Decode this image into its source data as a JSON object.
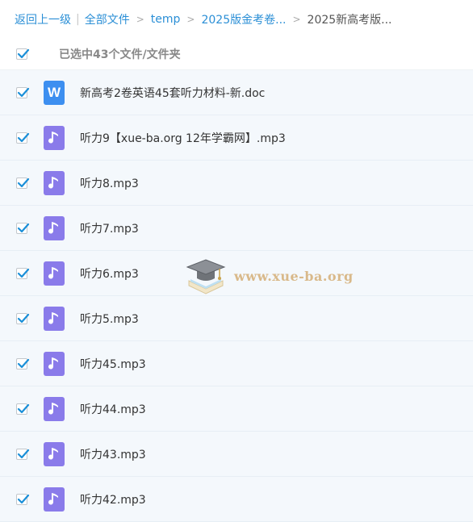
{
  "breadcrumb": {
    "back": "返回上一级",
    "all_files": "全部文件",
    "items": [
      "temp",
      "2025版金考卷...",
      "2025新高考版..."
    ]
  },
  "selection": {
    "all_checked": true,
    "label": "已选中43个文件/文件夹"
  },
  "files": [
    {
      "name": "新高考2卷英语45套听力材料-新.doc",
      "type": "doc",
      "icon_letter": "W",
      "checked": true
    },
    {
      "name": "听力9【xue-ba.org 12年学霸网】.mp3",
      "type": "mp3",
      "checked": true
    },
    {
      "name": "听力8.mp3",
      "type": "mp3",
      "checked": true
    },
    {
      "name": "听力7.mp3",
      "type": "mp3",
      "checked": true
    },
    {
      "name": "听力6.mp3",
      "type": "mp3",
      "checked": true
    },
    {
      "name": "听力5.mp3",
      "type": "mp3",
      "checked": true
    },
    {
      "name": "听力45.mp3",
      "type": "mp3",
      "checked": true
    },
    {
      "name": "听力44.mp3",
      "type": "mp3",
      "checked": true
    },
    {
      "name": "听力43.mp3",
      "type": "mp3",
      "checked": true
    },
    {
      "name": "听力42.mp3",
      "type": "mp3",
      "checked": true
    }
  ],
  "watermark": {
    "text": "www.xue-ba.org",
    "icon": "graduation-cap-book-icon"
  },
  "colors": {
    "link": "#2b8fd6",
    "check": "#1a8fd8",
    "row_bg": "#f4f8fc",
    "doc_icon": "#3d8ff0",
    "audio_icon": "#8a7bea"
  }
}
